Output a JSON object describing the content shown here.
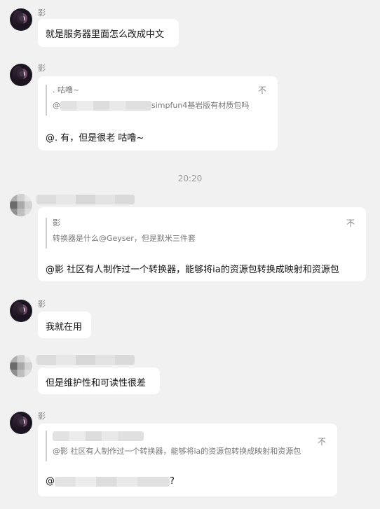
{
  "messages": [
    {
      "sender": "影",
      "text": "就是服务器里面怎么改成中文"
    },
    {
      "sender": "影",
      "quote": {
        "name": ". 咕噜~",
        "text_suffix": "simpfun4基岩版有材质包吗",
        "mention": "@"
      },
      "text": "@. 有，但是很老 咕噜~"
    },
    {
      "sender": "",
      "quote": {
        "name": "影",
        "text": "转换器是什么@Geyser，但是默米三件套"
      },
      "text": "@影 社区有人制作过一个转换器，能够将ia的资源包转换成映射和资源包"
    },
    {
      "sender": "影",
      "text": "我就在用"
    },
    {
      "sender": "",
      "text": "但是维护性和可读性很差"
    },
    {
      "sender": "影",
      "quote": {
        "name": "",
        "text": "@影 社区有人制作过一个转换器，能够将ia的资源包转换成映射和资源包"
      },
      "text_prefix": "@",
      "text_suffix": "?"
    }
  ],
  "timestamp": "20:20",
  "icons": {
    "pin": "pin-icon"
  }
}
